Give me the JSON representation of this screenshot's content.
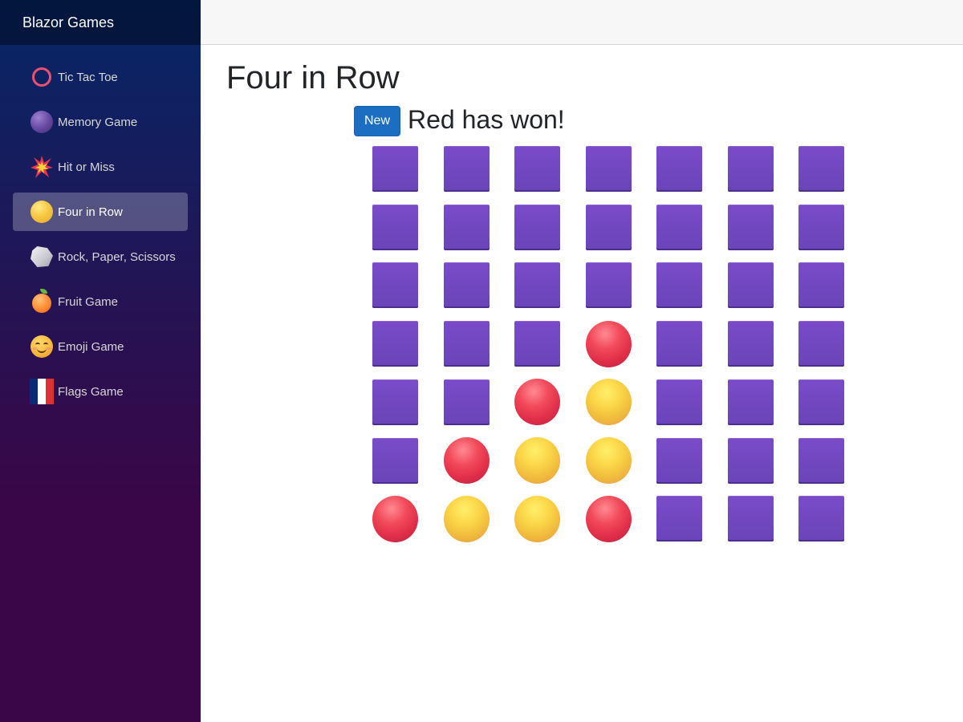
{
  "app": {
    "brand": "Blazor Games"
  },
  "nav": {
    "items": [
      {
        "label": "Tic Tac Toe",
        "icon": "ring-icon",
        "active": false
      },
      {
        "label": "Memory Game",
        "icon": "planet-orb-icon",
        "active": false
      },
      {
        "label": "Hit or Miss",
        "icon": "collision-icon",
        "active": false
      },
      {
        "label": "Four in Row",
        "icon": "yellow-ball-icon",
        "active": true
      },
      {
        "label": "Rock, Paper, Scissors",
        "icon": "rock-icon",
        "active": false
      },
      {
        "label": "Fruit Game",
        "icon": "tangerine-icon",
        "active": false
      },
      {
        "label": "Emoji Game",
        "icon": "smiling-face-icon",
        "active": false
      },
      {
        "label": "Flags Game",
        "icon": "france-flag-icon",
        "active": false
      }
    ]
  },
  "main": {
    "title": "Four in Row",
    "new_button": "New",
    "status": "Red has won!"
  },
  "board": {
    "rows": 7,
    "cols": 7,
    "cells": [
      [
        "empty",
        "empty",
        "empty",
        "empty",
        "empty",
        "empty",
        "empty"
      ],
      [
        "empty",
        "empty",
        "empty",
        "empty",
        "empty",
        "empty",
        "empty"
      ],
      [
        "empty",
        "empty",
        "empty",
        "empty",
        "empty",
        "empty",
        "empty"
      ],
      [
        "empty",
        "empty",
        "empty",
        "red",
        "empty",
        "empty",
        "empty"
      ],
      [
        "empty",
        "empty",
        "red",
        "yellow",
        "empty",
        "empty",
        "empty"
      ],
      [
        "empty",
        "red",
        "yellow",
        "yellow",
        "empty",
        "empty",
        "empty"
      ],
      [
        "red",
        "yellow",
        "yellow",
        "red",
        "empty",
        "empty",
        "empty"
      ]
    ]
  },
  "colors": {
    "sidebar_top": "#052767",
    "sidebar_bottom": "#3a0647",
    "slot": "#7048c0",
    "red_piece": "#e8364f",
    "yellow_piece": "#f7c844",
    "button": "#1b6ec2"
  }
}
